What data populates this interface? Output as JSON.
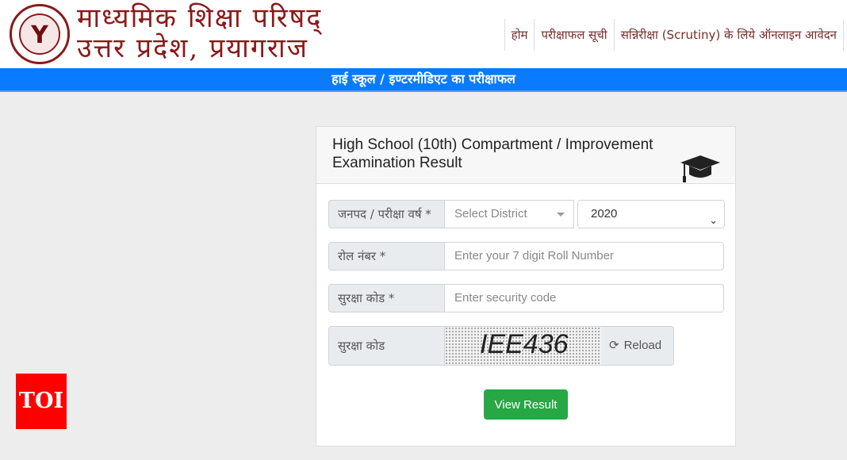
{
  "header": {
    "title_line1": "माध्यमिक शिक्षा परिषद्",
    "title_line2": "उत्तर प्रदेश, प्रयागराज",
    "logo_text": "Y",
    "nav": [
      {
        "label": "होम"
      },
      {
        "label": "परीक्षाफल सूची"
      },
      {
        "label": "सन्निरीक्षा (Scrutiny) के लिये ऑनलाइन आवेदन"
      }
    ]
  },
  "banner": {
    "text": "हाई स्कूल / इण्टरमीडिएट का परीक्षाफल"
  },
  "card": {
    "title": "High School (10th) Compartment / Improvement Examination Result",
    "icon": "graduation-cap-icon",
    "form": {
      "district_label": "जनपद / परीक्षा वर्ष *",
      "district_placeholder": "Select District",
      "year_value": "2020",
      "roll_label": "रोल नंबर *",
      "roll_placeholder": "Enter your 7 digit Roll Number",
      "security_label": "सुरक्षा कोड *",
      "security_placeholder": "Enter security code",
      "captcha_label": "सुरक्षा कोड",
      "captcha_text": "IEE436",
      "reload_label": "Reload",
      "submit_label": "View Result"
    }
  },
  "watermark": {
    "text": "TOI"
  },
  "colors": {
    "brand": "#8b1a1a",
    "banner": "#0a7aff",
    "submit": "#28a745",
    "toi": "#ff0000"
  }
}
